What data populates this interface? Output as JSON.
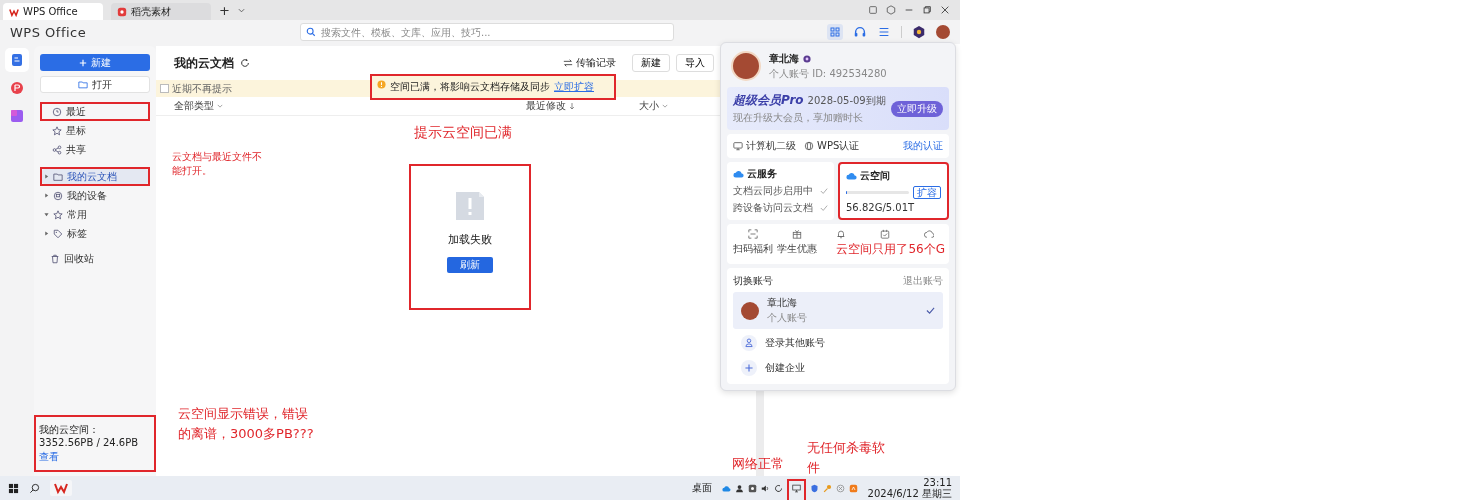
{
  "tabs": [
    {
      "label": "WPS Office",
      "selected": true
    },
    {
      "label": "稻壳素材",
      "selected": false
    }
  ],
  "new_tab": "+",
  "app_header": {
    "logo": "WPS Office",
    "search": {
      "placeholder": "搜索文件、模板、文库、应用、技巧..."
    }
  },
  "sidebar": {
    "new_button": "新建",
    "open_button": "打开",
    "quick_items": [
      {
        "label": "最近",
        "selected": false
      },
      {
        "label": "星标",
        "selected": false
      },
      {
        "label": "共享",
        "selected": false
      }
    ],
    "tree": [
      {
        "label": "我的云文档",
        "expanded": false,
        "selected": true
      },
      {
        "label": "我的设备",
        "expanded": false,
        "selected": false
      },
      {
        "label": "常用",
        "expanded": true,
        "selected": false
      },
      {
        "label": "标签",
        "expanded": false,
        "selected": false
      }
    ],
    "trash": "回收站",
    "storage": {
      "text": "我的云空间：3352.56PB / 24.6PB",
      "link": "查看"
    }
  },
  "main": {
    "title": "我的云文档",
    "transfer_link": "传输记录",
    "buttons": [
      "新建",
      "导入"
    ],
    "banner": {
      "dismiss": {
        "label": "近期不再提示",
        "checked": false
      },
      "message": "空间已满，将影响云文档存储及同步",
      "link": "立即扩容"
    },
    "columns": [
      {
        "label": "全部类型",
        "kind": "menu"
      },
      {
        "label": "最近修改",
        "kind": "sort"
      },
      {
        "label": "大小",
        "kind": "menu"
      }
    ],
    "empty_state": {
      "title": "加载失败",
      "button": "刷新"
    }
  },
  "account_panel": {
    "name": "章北海",
    "account_line": "个人账号 ID: 492534280",
    "pro": {
      "title": "超级会员Pro",
      "expiry": "2028-05-09到期",
      "subtitle": "现在升级大会员，享加赠时长",
      "button": "立即升级"
    },
    "links": [
      "计算机二级",
      "WPS认证"
    ],
    "my_cert": "我的认证",
    "cloud_service": {
      "title": "云服务",
      "items": [
        {
          "label": "文档云同步启用中",
          "checked": true
        },
        {
          "label": "跨设备访问云文档",
          "checked": true
        }
      ]
    },
    "cloud_space": {
      "title": "云空间",
      "level": 0.01,
      "usage": "56.82G/5.01T",
      "button": "扩容"
    },
    "shortcuts": [
      "扫码福利",
      "学生优惠"
    ],
    "switch_title": "切换账号",
    "logout": "退出账号",
    "accounts": [
      {
        "name": "章北海",
        "type": "个人账号",
        "selected": true
      }
    ],
    "other_actions": [
      "登录其他账号",
      "创建企业"
    ]
  },
  "taskbar": {
    "desktop": "桌面",
    "time": "23:11",
    "date": "2024/6/12 星期三"
  },
  "annotations": [
    "提示云空间已满",
    "云文档与最近文件不能打开。",
    "云空间只用了56个G",
    "云空间显示错误，错误的离谱，3000多PB???",
    "网络正常",
    "无任何杀毒软件"
  ]
}
